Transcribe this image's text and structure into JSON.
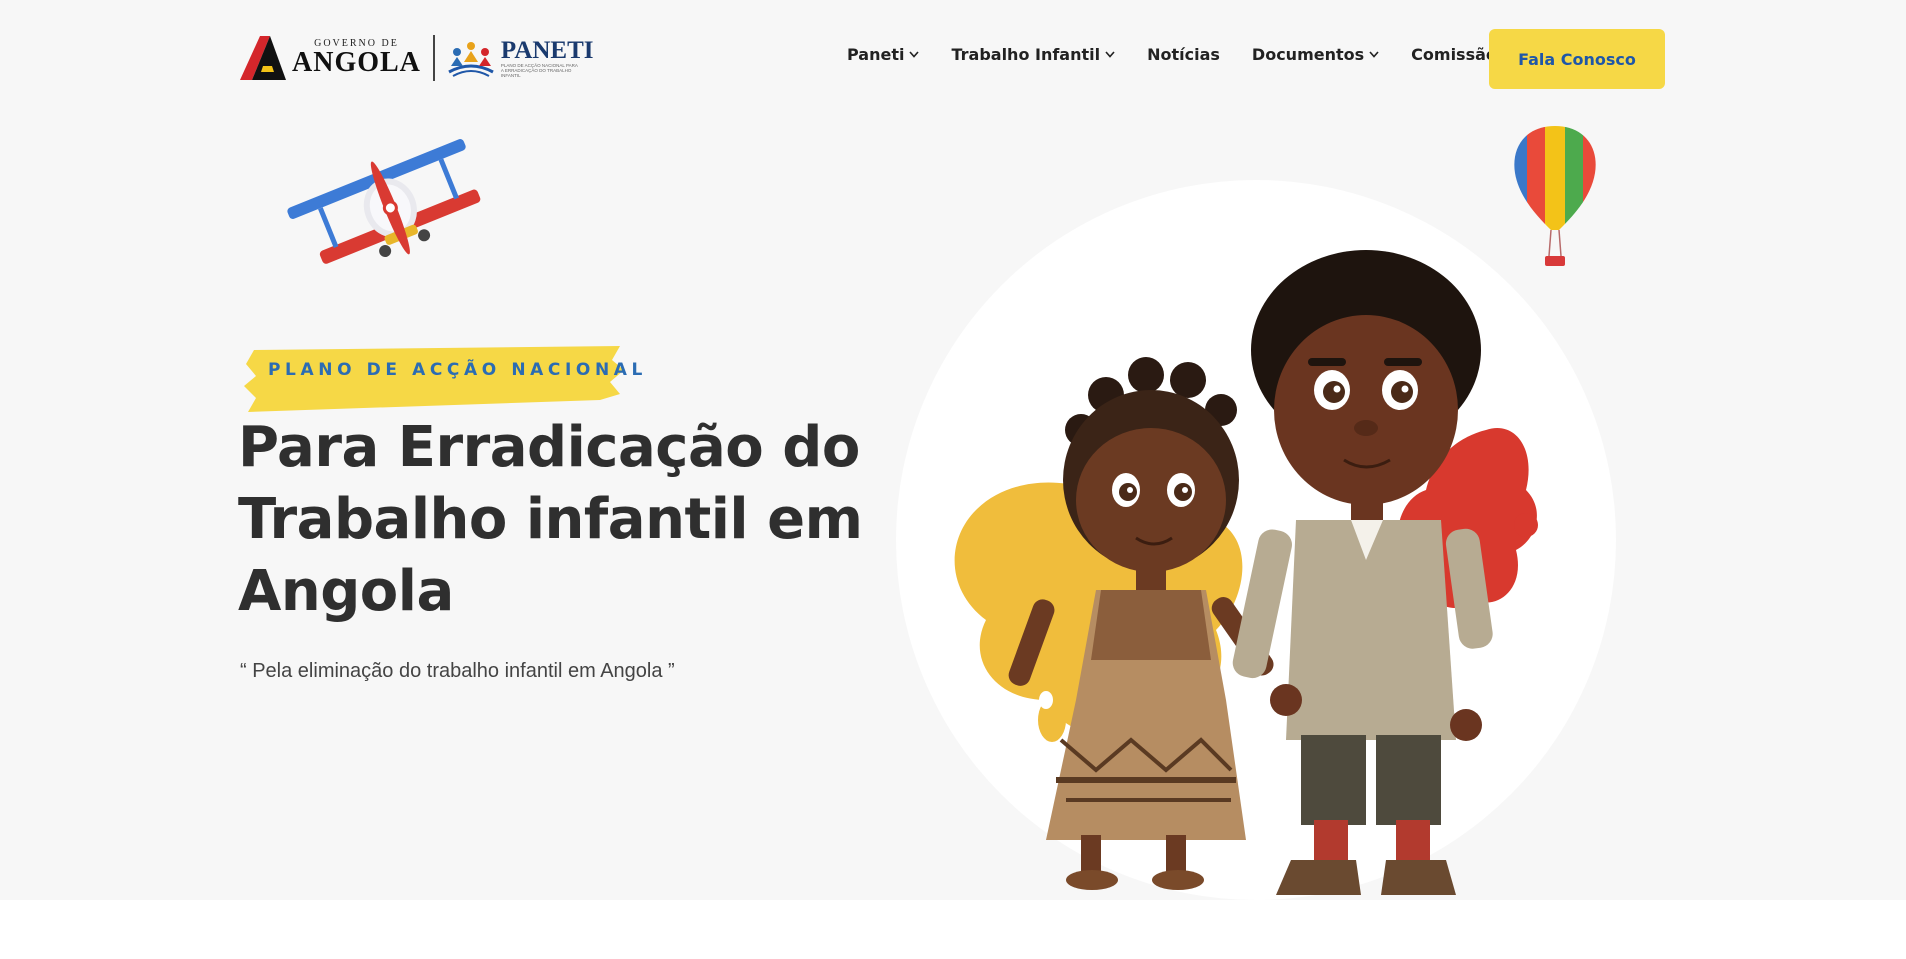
{
  "header": {
    "logo": {
      "gov_small": "GOVERNO DE",
      "gov_big": "ANGOLA",
      "paneti_name": "PANETI",
      "paneti_sub": "PLANO DE ACÇÃO NACIONAL PARA A ERRADICAÇÃO DO TRABALHO INFANTIL"
    },
    "nav": [
      {
        "label": "Paneti",
        "dropdown": true
      },
      {
        "label": "Trabalho Infantil",
        "dropdown": true
      },
      {
        "label": "Notícias",
        "dropdown": false
      },
      {
        "label": "Documentos",
        "dropdown": true
      },
      {
        "label": "Comissão",
        "dropdown": true
      }
    ],
    "cta_label": "Fala Conosco"
  },
  "hero": {
    "tagline": "PLANO DE ACÇÃO NACIONAL",
    "title_lines": [
      "Para Erradicação do",
      "Trabalho infantil em",
      "Angola"
    ],
    "quote": "“ Pela eliminação do trabalho infantil em Angola ”"
  },
  "colors": {
    "accent_yellow": "#f6d846",
    "link_blue": "#1f57a8",
    "tag_blue": "#2b6cb3",
    "hero_bg": "#f7f7f7",
    "text_dark": "#2f2f2f"
  },
  "icons": {
    "dropdown": "chevron-down-icon",
    "plane": "biplane-illustration",
    "balloon": "hot-air-balloon-illustration",
    "children": "children-illustration"
  }
}
